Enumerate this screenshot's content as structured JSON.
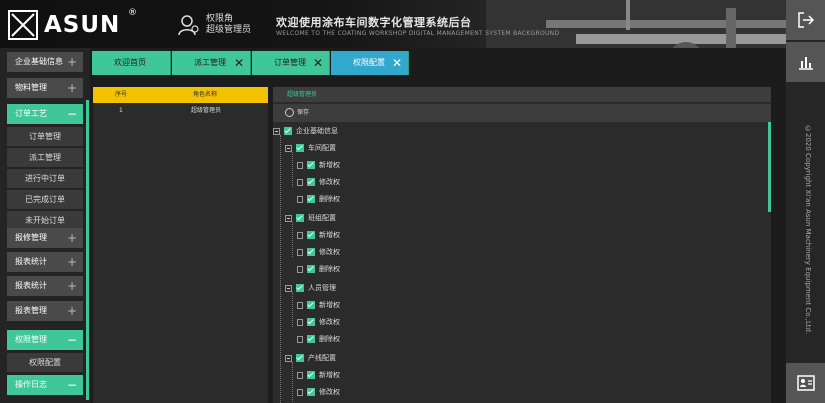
{
  "header": {
    "brand": "ASUN",
    "brand_mark": "®",
    "user_line1": "权限角",
    "user_line2": "超级管理员",
    "system_title": "欢迎使用涂布车间数字化管理系统后台",
    "system_subtitle": "WELCOME TO THE COATING WORKSHOP DIGITAL MANAGEMENT SYSTEM BACKGROUND"
  },
  "rail": {
    "copyright": "©2020 Copyright Xi'an Asun Machinery Equipment Co.,Ltd.",
    "icons": [
      "logout-icon",
      "chart-icon",
      "id-card-icon"
    ]
  },
  "sidebar": {
    "items": [
      {
        "label": "企业基础信息",
        "sign": "+"
      },
      {
        "label": "物料管理",
        "sign": "+"
      },
      {
        "label": "订单工艺",
        "sign": "−",
        "active": true
      },
      {
        "label": "订单管理"
      },
      {
        "label": "派工管理"
      },
      {
        "label": "进行中订单"
      },
      {
        "label": "已完成订单"
      },
      {
        "label": "未开始订单"
      },
      {
        "label": "报修管理",
        "sign": "+"
      },
      {
        "label": "报表统计",
        "sign": "+"
      },
      {
        "label": "报表统计",
        "sign": "+"
      },
      {
        "label": "报表管理",
        "sign": "+"
      },
      {
        "label": "权限管理",
        "sign": "−",
        "active": true
      },
      {
        "label": "权限配置"
      },
      {
        "label": "操作日志",
        "sign": "−",
        "active": true
      }
    ]
  },
  "tabs": [
    {
      "label": "欢迎首页",
      "closable": false
    },
    {
      "label": "派工管理",
      "closable": true
    },
    {
      "label": "订单管理",
      "closable": true
    },
    {
      "label": "权限配置",
      "closable": true,
      "active": true
    }
  ],
  "role_table": {
    "headers": [
      "序号",
      "角色名称"
    ],
    "rows": [
      [
        "1",
        "超级管理员"
      ]
    ]
  },
  "permission_panel": {
    "title": "超级管理员",
    "save_label": "保存",
    "tree": [
      {
        "label": "企业基础信息",
        "level": 0
      },
      {
        "label": "车间配置",
        "level": 1
      },
      {
        "label": "新增权",
        "level": 2
      },
      {
        "label": "修改权",
        "level": 2
      },
      {
        "label": "删除权",
        "level": 2
      },
      {
        "label": "班组配置",
        "level": 1
      },
      {
        "label": "新增权",
        "level": 2
      },
      {
        "label": "修改权",
        "level": 2
      },
      {
        "label": "删除权",
        "level": 2
      },
      {
        "label": "人员管理",
        "level": 1
      },
      {
        "label": "新增权",
        "level": 2
      },
      {
        "label": "修改权",
        "level": 2
      },
      {
        "label": "删除权",
        "level": 2
      },
      {
        "label": "产线配置",
        "level": 1
      },
      {
        "label": "新增权",
        "level": 2
      },
      {
        "label": "修改权",
        "level": 2
      }
    ]
  },
  "colors": {
    "accent": "#3fc79a",
    "active_tab": "#32a8cc",
    "table_header": "#f2c200"
  }
}
